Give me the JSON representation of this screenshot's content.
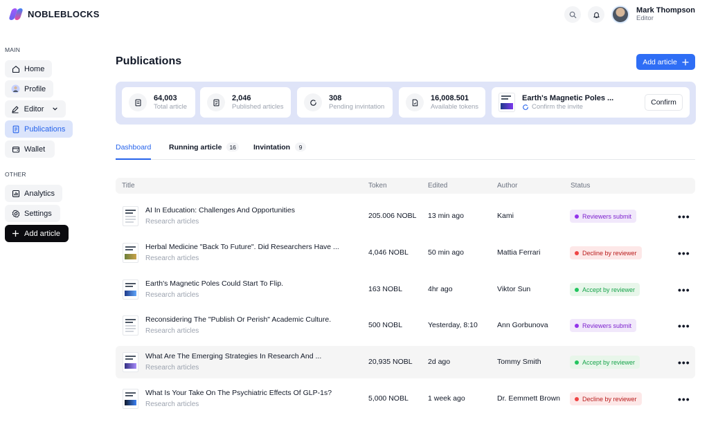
{
  "brand": {
    "name": "NOBLEBLOCKS",
    "colors": {
      "accent": "#2f6ef5",
      "highlight_bg": "#dfe4f8"
    }
  },
  "header": {
    "search_icon": "search-icon",
    "bell_icon": "bell-icon",
    "user": {
      "name": "Mark Thompson",
      "role": "Editor"
    }
  },
  "sidebar": {
    "section_main": "MAIN",
    "main_items": [
      {
        "label": "Home",
        "icon": "home-icon"
      },
      {
        "label": "Profile",
        "icon": "profile-icon"
      },
      {
        "label": "Editor",
        "icon": "pen-icon"
      },
      {
        "label": "Publications",
        "icon": "document-icon",
        "active": true
      },
      {
        "label": "Wallet",
        "icon": "wallet-icon"
      }
    ],
    "section_other": "OTHER",
    "other_items": [
      {
        "label": "Analytics",
        "icon": "analytics-icon"
      },
      {
        "label": "Settings",
        "icon": "gear-icon"
      },
      {
        "label": "Add article",
        "icon": "plus-icon"
      }
    ]
  },
  "main": {
    "title": "Publications",
    "add_button": "Add article",
    "stats": [
      {
        "value": "64,003",
        "label": "Total article"
      },
      {
        "value": "2,046",
        "label": "Published articles"
      },
      {
        "value": "308",
        "label": "Pending invintation"
      },
      {
        "value": "16,008.501",
        "label": "Available tokens"
      }
    ],
    "invite": {
      "title": "Earth's Magnetic Poles ...",
      "status": "Confirm the invite",
      "button": "Confirm"
    },
    "tabs": [
      {
        "label": "Dashboard",
        "active": true
      },
      {
        "label": "Running article",
        "count": "16"
      },
      {
        "label": "Invintation",
        "count": "9"
      }
    ],
    "table": {
      "columns": [
        "Title",
        "Token",
        "Edited",
        "Author",
        "Status"
      ],
      "rows": [
        {
          "title": "AI In Education: Challenges And Opportunities",
          "category": "Research articles",
          "token": "205.006 NOBL",
          "edited": "13 min ago",
          "author": "Kami",
          "status": "Reviewers submit",
          "status_color": "purple"
        },
        {
          "title": "Herbal Medicine \"Back To Future\". Did Researchers Have ...",
          "category": "Research articles",
          "token": "4,046 NOBL",
          "edited": "50 min ago",
          "author": "Mattia Ferrari",
          "status": "Decline by reviewer",
          "status_color": "red"
        },
        {
          "title": "Earth's Magnetic Poles Could Start To Flip.",
          "category": "Research articles",
          "token": "163 NOBL",
          "edited": "4hr ago",
          "author": "Viktor Sun",
          "status": "Accept by reviewer",
          "status_color": "green"
        },
        {
          "title": "Reconsidering The \"Publish Or Perish\" Academic Culture.",
          "category": "Research articles",
          "token": "500 NOBL",
          "edited": "Yesterday, 8:10",
          "author": "Ann Gorbunova",
          "status": "Reviewers submit",
          "status_color": "purple"
        },
        {
          "title": "What Are The Emerging Strategies In Research And ...",
          "category": "Research articles",
          "token": "20,935 NOBL",
          "edited": "2d ago",
          "author": "Tommy Smith",
          "status": "Accept by reviewer",
          "status_color": "green"
        },
        {
          "title": "What Is Your Take On The Psychiatric Effects Of GLP-1s?",
          "category": "Research articles",
          "token": "5,000 NOBL",
          "edited": "1 week ago",
          "author": "Dr. Eemmett Brown",
          "status": "Decline by reviewer",
          "status_color": "red"
        }
      ]
    }
  }
}
